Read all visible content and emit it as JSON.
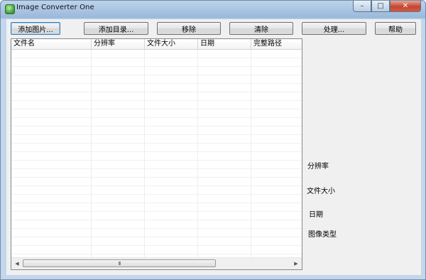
{
  "window": {
    "title": "Image Converter One",
    "minimize": "–",
    "maximize": "□",
    "close": "✕"
  },
  "toolbar": {
    "add_image": "添加图片...",
    "add_folder": "添加目录...",
    "remove": "移除",
    "clear": "清除",
    "process": "处理...",
    "help": "帮助"
  },
  "filelist": {
    "columns": [
      "文件名",
      "分辨率",
      "文件大小",
      "日期",
      "完整路径"
    ],
    "rows": [],
    "scroll_grip": "III"
  },
  "info": {
    "resolution_label": "分辨率",
    "filesize_label": "文件大小",
    "date_label": "日期",
    "imagetype_label": "图像类型"
  },
  "icons": {
    "app": "app-icon",
    "scroll_left": "◀",
    "scroll_right": "▶"
  }
}
